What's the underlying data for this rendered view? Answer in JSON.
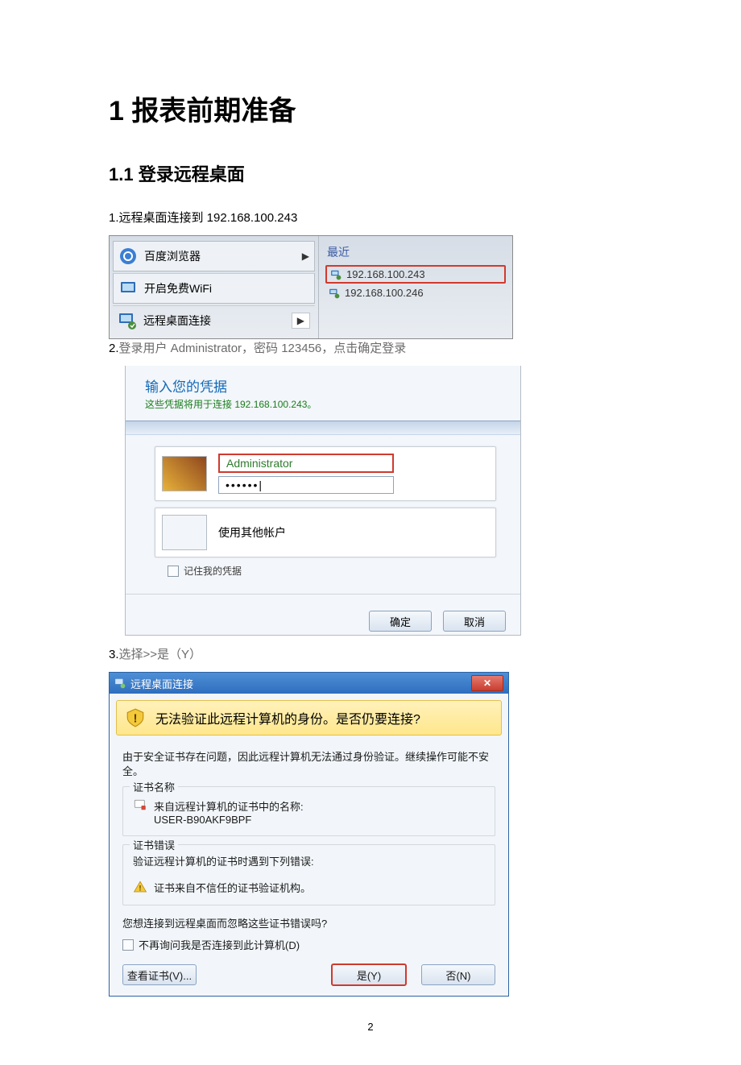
{
  "heading1": "1 报表前期准备",
  "heading2": "1.1 登录远程桌面",
  "step1": "1.远程桌面连接到 192.168.100.243",
  "shot1": {
    "baidu": "百度浏览器",
    "wifi": "开启免费WiFi",
    "rdc": "远程桌面连接",
    "recent": "最近",
    "addr1": "192.168.100.243",
    "addr2": "192.168.100.246"
  },
  "step2_a": "2.",
  "step2_b": "登录用户 Administrator，密码 123456，点击确定登录",
  "shot2": {
    "title": "输入您的凭据",
    "sub": "这些凭据将用于连接 192.168.100.243。",
    "user": "Administrator",
    "pwd": "••••••|",
    "other": "使用其他帐户",
    "remember": "记住我的凭据",
    "ok": "确定",
    "cancel": "取消"
  },
  "step3_a": "3.",
  "step3_b": "选择>>是（Y）",
  "shot3": {
    "title": "远程桌面连接",
    "close": "✕",
    "warn": "无法验证此远程计算机的身份。是否仍要连接?",
    "body1": "由于安全证书存在问题，因此远程计算机无法通过身份验证。继续操作可能不安全。",
    "grp1_legend": "证书名称",
    "grp1_l1": "来自远程计算机的证书中的名称:",
    "grp1_l2": "USER-B90AKF9BPF",
    "grp2_legend": "证书错误",
    "grp2_l1": "验证远程计算机的证书时遇到下列错误:",
    "grp2_l2": "证书来自不信任的证书验证机构。",
    "q": "您想连接到远程桌面而忽略这些证书错误吗?",
    "dont": "不再询问我是否连接到此计算机(D)",
    "view": "查看证书(V)...",
    "yes": "是(Y)",
    "no": "否(N)"
  },
  "pagenum": "2"
}
